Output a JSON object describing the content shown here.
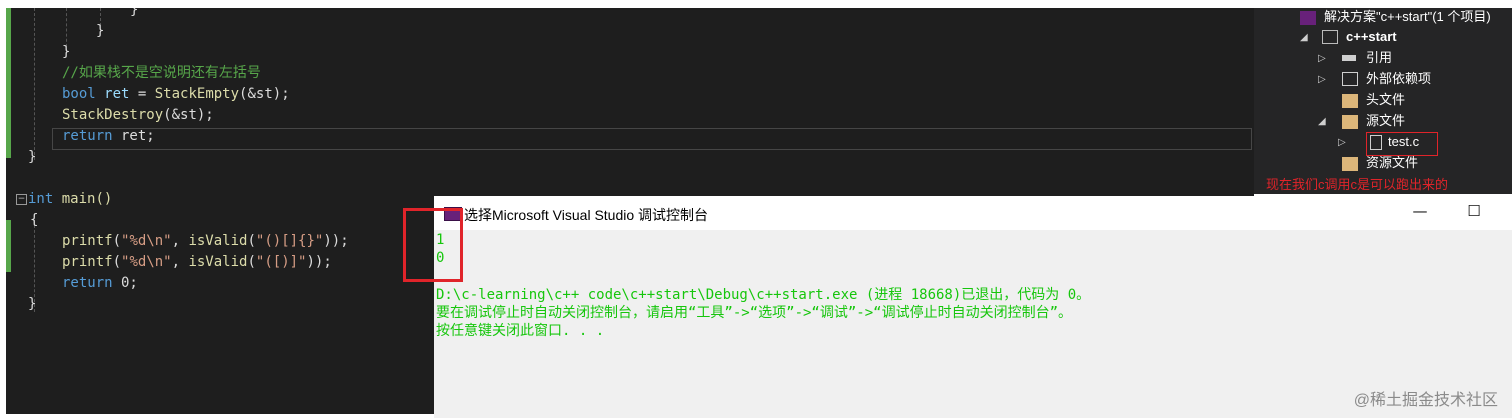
{
  "editor": {
    "lines": {
      "l1": "}",
      "l2": "}",
      "l3": "}",
      "comment": "//如果栈不是空说明还有左括号",
      "bool_kw": "bool",
      "ret_var": "ret",
      "eq": " = ",
      "stack_empty": "StackEmpty",
      "stack_empty_args": "(&st);",
      "stack_destroy": "StackDestroy",
      "stack_destroy_args": "(&st);",
      "return_kw": "return",
      "ret_end": " ret;",
      "close_brace": "}",
      "int_kw": "int",
      "main_fn": " main()",
      "open_brace": "{",
      "printf": "printf",
      "printf1_open": "(",
      "fmt": "\"%d\\n\"",
      "comma": ", ",
      "isvalid": "isValid",
      "arg1": "\"()[]{}\"",
      "arg2": "\"([)]\"",
      "printf_close": "));",
      "return0": " 0;",
      "end_brace": "}"
    }
  },
  "solution_explorer": {
    "solution": "解决方案\"c++start\"(1 个项目)",
    "project": "c++start",
    "references": "引用",
    "external_deps": "外部依赖项",
    "headers": "头文件",
    "sources": "源文件",
    "test_file": "test.c",
    "resources": "资源文件"
  },
  "annotation": "现在我们c调用c是可以跑出来的",
  "console": {
    "title": "选择Microsoft Visual Studio 调试控制台",
    "minimize": "—",
    "maximize": "☐",
    "output_1": "1",
    "output_2": "0",
    "exit_line": "D:\\c-learning\\c++ code\\c++start\\Debug\\c++start.exe (进程 18668)已退出，代码为 0。",
    "hint_line": "要在调试停止时自动关闭控制台，请启用“工具”->“选项”->“调试”->“调试停止时自动关闭控制台”。",
    "press_line": "按任意键关闭此窗口. . ."
  },
  "watermark": "@稀土掘金技术社区",
  "colors": {
    "editor_bg": "#1e1e1e",
    "keyword": "#569cd6",
    "function": "#dcdcaa",
    "string": "#d69d85",
    "comment": "#57a64a",
    "console_text": "#16c60c",
    "highlight_red": "#e0242a"
  }
}
